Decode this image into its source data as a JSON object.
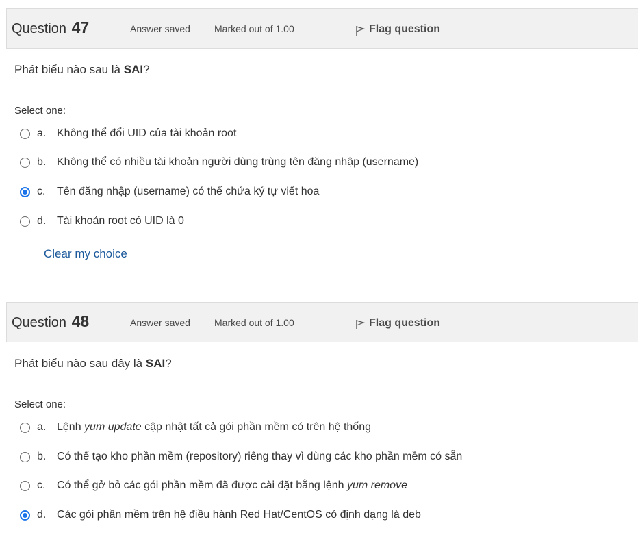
{
  "questions": [
    {
      "label": "Question",
      "number": "47",
      "state": "Answer saved",
      "grade": "Marked out of 1.00",
      "flag_label": "Flag question",
      "text_before": "Phát biểu nào sau là ",
      "text_bold": "SAI",
      "text_after": "?",
      "prompt": "Select one:",
      "options": [
        {
          "letter": "a.",
          "text": "Không thể đổi UID của tài khoản root",
          "checked": false
        },
        {
          "letter": "b.",
          "text": "Không thể có nhiều tài khoản người dùng trùng tên đăng nhập (username)",
          "checked": false
        },
        {
          "letter": "c.",
          "text": "Tên đăng nhập (username) có thể chứa ký tự viết hoa",
          "checked": true
        },
        {
          "letter": "d.",
          "text": "Tài khoản root có UID là 0",
          "checked": false
        }
      ],
      "clear_label": "Clear my choice"
    },
    {
      "label": "Question",
      "number": "48",
      "state": "Answer saved",
      "grade": "Marked out of 1.00",
      "flag_label": "Flag question",
      "text_before": "Phát biểu nào sau đây là ",
      "text_bold": "SAI",
      "text_after": "?",
      "prompt": "Select one:",
      "options": [
        {
          "letter": "a.",
          "pre": "Lệnh ",
          "em": "yum update",
          "post": " cập nhật tất cả gói phần mềm có trên hệ thống",
          "checked": false
        },
        {
          "letter": "b.",
          "text": "Có thể tạo kho phần mềm (repository) riêng thay vì dùng các kho phần mềm có sẵn",
          "checked": false
        },
        {
          "letter": "c.",
          "pre": "Có thể gở bỏ các gói phần mềm đã được cài đặt bằng lệnh ",
          "em": "yum remove",
          "post": "",
          "checked": false
        },
        {
          "letter": "d.",
          "text": "Các gói phần mềm trên hệ điều hành Red Hat/CentOS có định dạng là deb",
          "checked": true
        }
      ]
    }
  ],
  "icons": {
    "flag": "flag-outline-icon",
    "radio": "radio-button"
  },
  "colors": {
    "accent": "#1a73e8",
    "link": "#1d5a9c",
    "header_bg": "#f1f1f1"
  }
}
